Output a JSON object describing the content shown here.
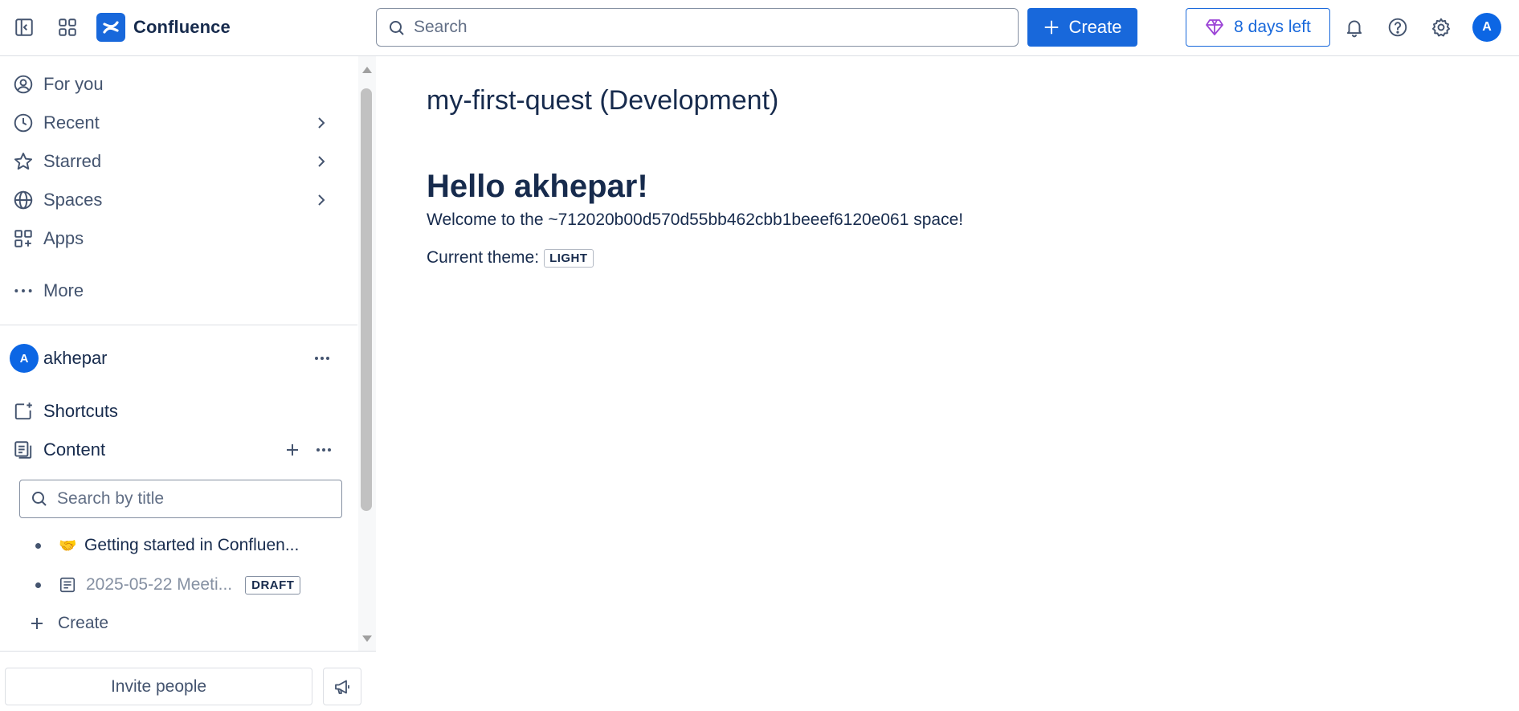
{
  "topbar": {
    "app_name": "Confluence",
    "search_placeholder": "Search",
    "create_label": "Create",
    "trial_label": "8 days left",
    "avatar_initial": "A"
  },
  "sidebar": {
    "nav": [
      {
        "label": "For you",
        "icon": "user-circle-icon"
      },
      {
        "label": "Recent",
        "icon": "clock-icon",
        "expandable": true
      },
      {
        "label": "Starred",
        "icon": "star-icon",
        "expandable": true
      },
      {
        "label": "Spaces",
        "icon": "globe-icon",
        "expandable": true
      },
      {
        "label": "Apps",
        "icon": "apps-icon"
      },
      {
        "label": "More",
        "icon": "more-icon"
      }
    ],
    "space": {
      "avatar_initial": "A",
      "name": "akhepar"
    },
    "shortcuts_label": "Shortcuts",
    "content_label": "Content",
    "tree_search_placeholder": "Search by title",
    "tree": [
      {
        "emoji": "🤝",
        "label": "Getting started in Confluen..."
      },
      {
        "label": "2025-05-22 Meeti...",
        "badge": "DRAFT"
      }
    ],
    "tree_create_label": "Create",
    "invite_label": "Invite people"
  },
  "main": {
    "space_title": "my-first-quest (Development)",
    "heading": "Hello akhepar!",
    "welcome": "Welcome to the ~712020b00d570d55bb462cbb1beeef6120e061 space!",
    "theme_label": "Current theme:",
    "theme_value": "LIGHT"
  },
  "colors": {
    "brand": "#1868db",
    "text": "#172b4d",
    "subtle": "#44546f",
    "border": "#dcdfe4"
  }
}
